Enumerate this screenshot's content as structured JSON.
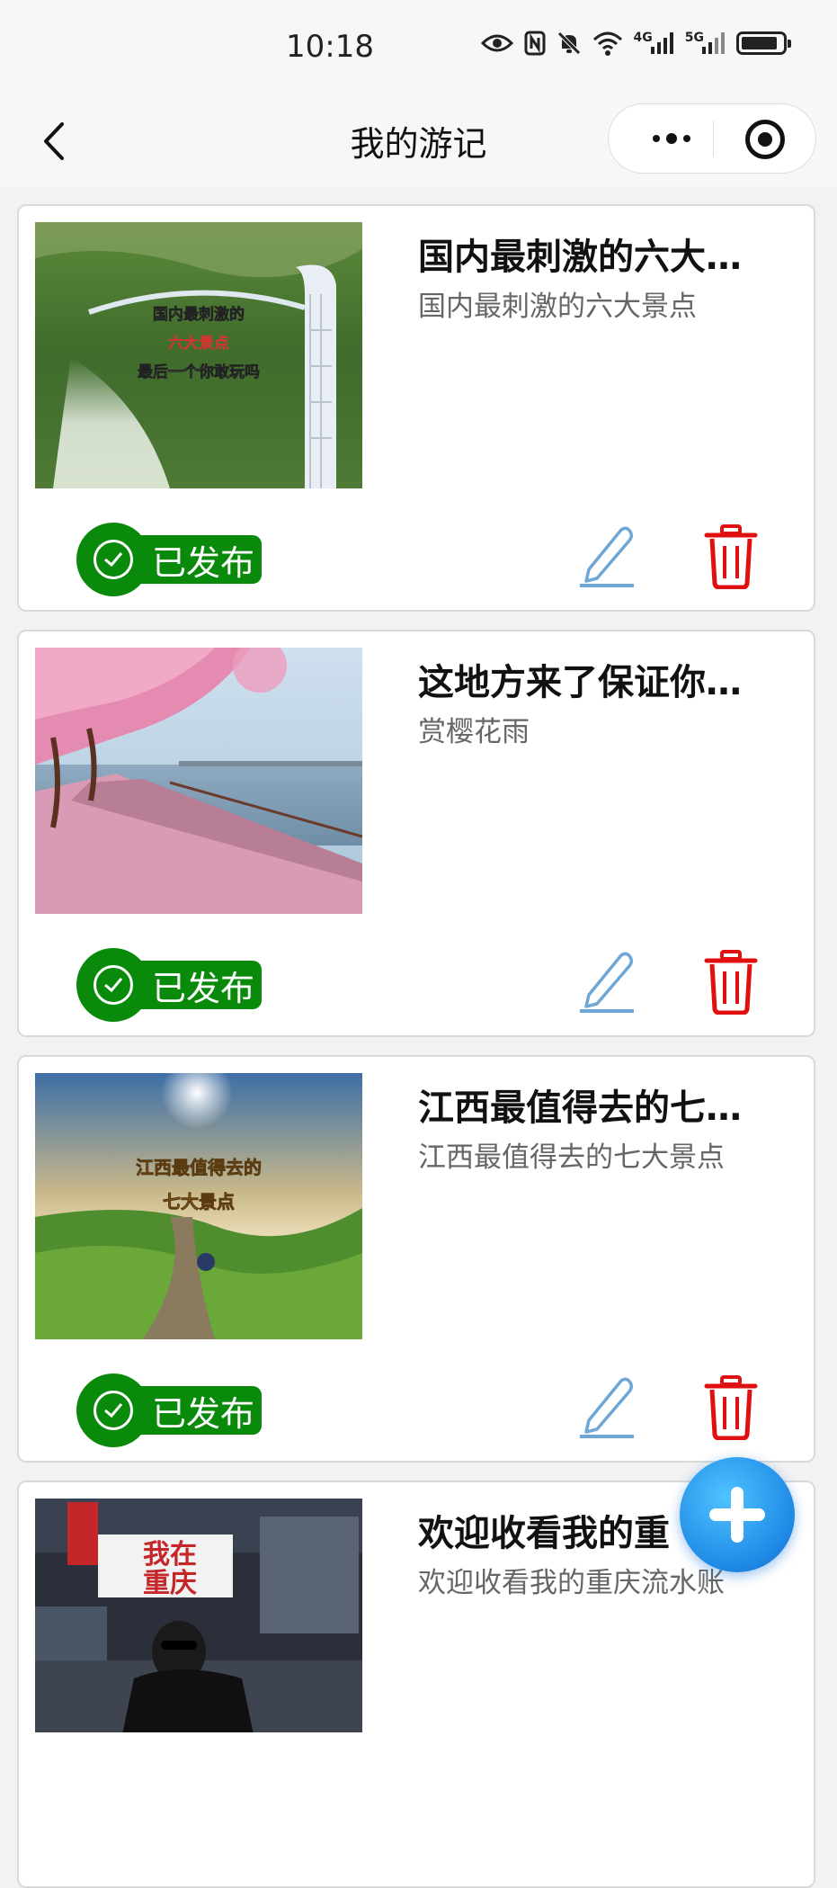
{
  "status_bar": {
    "time": "10:18",
    "net1": "4G",
    "net2": "5G"
  },
  "nav": {
    "title": "我的游记"
  },
  "colors": {
    "published_green": "#0a8a0a",
    "edit_blue": "#6ea6d6",
    "delete_red": "#e01010",
    "fab_blue": "#1e88e5"
  },
  "notes": [
    {
      "title": "国内最刺激的六大…",
      "subtitle": "国内最刺激的六大景点",
      "status": "已发布",
      "thumb_caption": [
        "国内最刺激的",
        "六大景点",
        "最后一个你敢玩吗"
      ]
    },
    {
      "title": "这地方来了保证你…",
      "subtitle": "赏樱花雨",
      "status": "已发布",
      "thumb_caption": []
    },
    {
      "title": "江西最值得去的七…",
      "subtitle": "江西最值得去的七大景点",
      "status": "已发布",
      "thumb_caption": [
        "江西最值得去的",
        "七大景点"
      ]
    },
    {
      "title": "欢迎收看我的重",
      "subtitle": "欢迎收看我的重庆流水账",
      "status": "",
      "thumb_caption": [
        "我在",
        "重庆"
      ]
    }
  ],
  "icons": {
    "back": "chevron-left-icon",
    "more": "more-dots-icon",
    "close": "target-icon",
    "edit": "pencil-icon",
    "delete": "trash-icon",
    "add": "plus-icon",
    "published": "check-circle-icon"
  }
}
